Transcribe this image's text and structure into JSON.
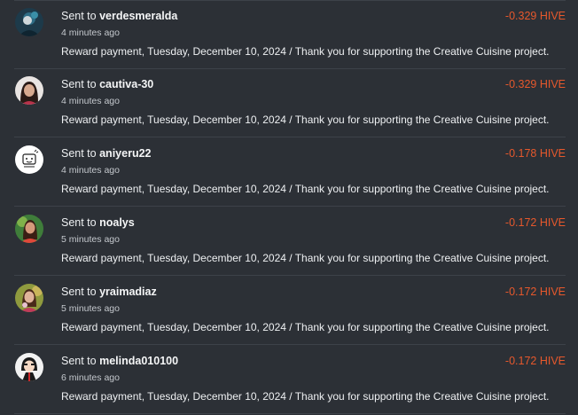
{
  "colors": {
    "background": "#2c3036",
    "divider": "#3d4249",
    "text": "#eef0f2",
    "muted": "#c4c8cd",
    "amount": "#e6582c"
  },
  "transactions": [
    {
      "prefix": "Sent to",
      "username": "verdesmeralda",
      "time_ago": "4 minutes ago",
      "memo": "Reward payment, Tuesday, December 10, 2024 / Thank you for supporting the Creative Cuisine project.",
      "amount": "-0.329 HIVE",
      "avatar": "user-photo-avatar"
    },
    {
      "prefix": "Sent to",
      "username": "cautiva-30",
      "time_ago": "4 minutes ago",
      "memo": "Reward payment, Tuesday, December 10, 2024 / Thank you for supporting the Creative Cuisine project.",
      "amount": "-0.329 HIVE",
      "avatar": "user-photo-avatar"
    },
    {
      "prefix": "Sent to",
      "username": "aniyeru22",
      "time_ago": "4 minutes ago",
      "memo": "Reward payment, Tuesday, December 10, 2024 / Thank you for supporting the Creative Cuisine project.",
      "amount": "-0.178 HIVE",
      "avatar": "drawn-logo-avatar"
    },
    {
      "prefix": "Sent to",
      "username": "noalys",
      "time_ago": "5 minutes ago",
      "memo": "Reward payment, Tuesday, December 10, 2024 / Thank you for supporting the Creative Cuisine project.",
      "amount": "-0.172 HIVE",
      "avatar": "user-photo-avatar"
    },
    {
      "prefix": "Sent to",
      "username": "yraimadiaz",
      "time_ago": "5 minutes ago",
      "memo": "Reward payment, Tuesday, December 10, 2024 / Thank you for supporting the Creative Cuisine project.",
      "amount": "-0.172 HIVE",
      "avatar": "user-photo-avatar"
    },
    {
      "prefix": "Sent to",
      "username": "melinda010100",
      "time_ago": "6 minutes ago",
      "memo": "Reward payment, Tuesday, December 10, 2024 / Thank you for supporting the Creative Cuisine project.",
      "amount": "-0.172 HIVE",
      "avatar": "cartoon-avatar"
    }
  ]
}
